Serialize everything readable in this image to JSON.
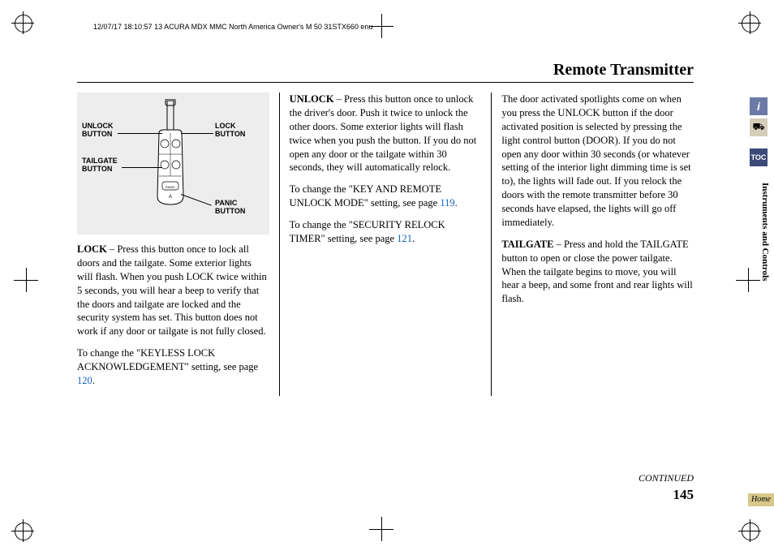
{
  "print_header": "12/07/17 18:10:57 13 ACURA MDX MMC North America Owner's M 50 31STX660 enu",
  "page_title": "Remote Transmitter",
  "diagram": {
    "unlock_label": "UNLOCK BUTTON",
    "lock_label": "LOCK BUTTON",
    "tailgate_label": "TAILGATE BUTTON",
    "panic_label": "PANIC BUTTON"
  },
  "col1": {
    "p1a": "LOCK",
    "p1b": " – Press this button once to lock all doors and the tailgate. Some exterior lights will flash. When you push LOCK twice within 5 seconds, you will hear a beep to verify that the doors and tailgate are locked and the security system has set. This button does not work if any door or tailgate is not fully closed.",
    "p2a": "To change the \"KEYLESS LOCK ACKNOWLEDGEMENT\" setting, see page ",
    "p2link": "120",
    "p2b": "."
  },
  "col2": {
    "p1a": "UNLOCK",
    "p1b": " – Press this button once to unlock the driver's door. Push it twice to unlock the other doors. Some exterior lights will flash twice when you push the button. If you do not open any door or the tailgate within 30 seconds, they will automatically relock.",
    "p2a": "To change the \"KEY AND REMOTE UNLOCK MODE\" setting, see page ",
    "p2link": "119",
    "p2b": ".",
    "p3a": "To change the \"SECURITY RELOCK TIMER\" setting, see page ",
    "p3link": "121",
    "p3b": "."
  },
  "col3": {
    "p1": "The door activated spotlights come on when you press the UNLOCK button if the door activated position is selected by pressing the light control button (DOOR). If you do not open any door within 30 seconds (or whatever setting of the interior light dimming time is set to), the lights will fade out. If you relock the doors with the remote transmitter before 30 seconds have elapsed, the lights will go off immediately.",
    "p2a": "TAILGATE",
    "p2b": " – Press and hold the TAILGATE button to open or close the power tailgate. When the tailgate begins to move, you will hear a beep, and some front and rear lights will flash."
  },
  "continued": "CONTINUED",
  "page_num": "145",
  "side": {
    "info": "i",
    "car": "⛟",
    "toc": "TOC",
    "section": "Instruments and Controls",
    "home": "Home"
  }
}
